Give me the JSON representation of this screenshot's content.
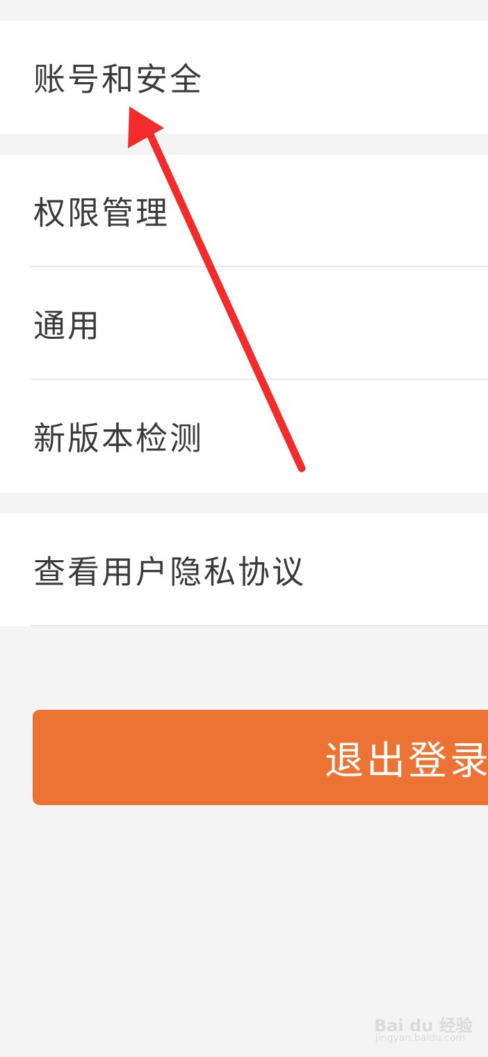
{
  "settings": {
    "account_security": "账号和安全",
    "permission_management": "权限管理",
    "general": "通用",
    "version_check": "新版本检测",
    "privacy_policy": "查看用户隐私协议"
  },
  "logout": {
    "label": "退出登录"
  },
  "annotation": {
    "color": "#f22b2b"
  },
  "watermark": {
    "brand": "Bai du 经验",
    "url": "jingyan.baidu.com"
  },
  "colors": {
    "background": "#f4f4f4",
    "surface": "#ffffff",
    "text": "#3a3a3a",
    "accent": "#ec7333"
  }
}
